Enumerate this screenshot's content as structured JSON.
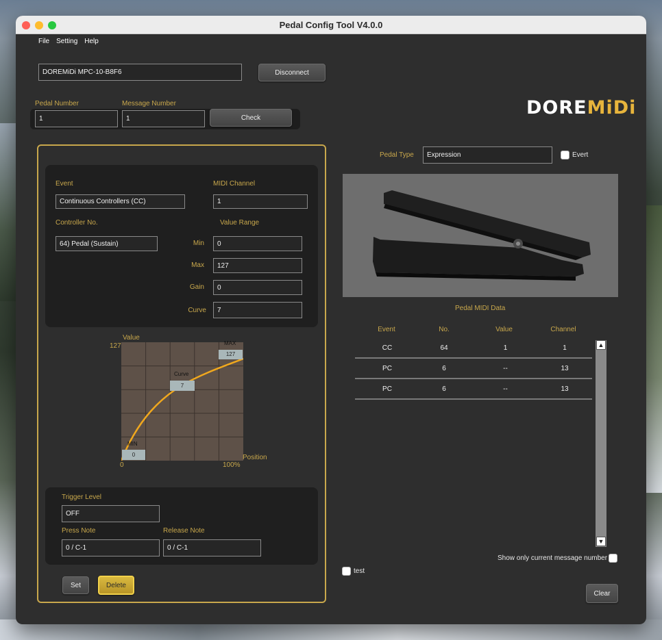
{
  "window": {
    "title": "Pedal Config Tool V4.0.0"
  },
  "menu": [
    "File",
    "Setting",
    "Help"
  ],
  "device": {
    "name": "DOREMiDi MPC-10-B8F6",
    "disconnect_label": "Disconnect"
  },
  "select": {
    "pedal_number_label": "Pedal Number",
    "pedal_number": "1",
    "message_number_label": "Message Number",
    "message_number": "1",
    "check_label": "Check"
  },
  "logo": {
    "part1": "DORE",
    "part2": "MiDi"
  },
  "event_panel": {
    "event_label": "Event",
    "event_value": "Continuous Controllers (CC)",
    "channel_label": "MIDI Channel",
    "channel_value": "1",
    "controller_label": "Controller No.",
    "controller_value": "64) Pedal (Sustain)",
    "value_range_label": "Value Range",
    "min_label": "Min",
    "min_value": "0",
    "max_label": "Max",
    "max_value": "127",
    "gain_label": "Gain",
    "gain_value": "0",
    "curve_label": "Curve",
    "curve_value": "7"
  },
  "graph": {
    "value_label": "Value",
    "y_max": "127",
    "max_label": "MAX",
    "max_value": "127",
    "curve_label": "Curve",
    "curve_value": "7",
    "min_label": "MIN",
    "min_value": "0",
    "x_min": "0",
    "x_max": "100%",
    "position_label": "Position"
  },
  "trigger": {
    "trigger_label": "Trigger Level",
    "trigger_value": "OFF",
    "press_label": "Press Note",
    "press_value": "0 / C-1",
    "release_label": "Release Note",
    "release_value": "0 / C-1"
  },
  "actions": {
    "set_label": "Set",
    "delete_label": "Delete"
  },
  "pedal": {
    "type_label": "Pedal Type",
    "type_value": "Expression",
    "evert_label": "Evert"
  },
  "midi_data": {
    "title": "Pedal MIDI Data",
    "columns": [
      "Event",
      "No.",
      "Value",
      "Channel"
    ],
    "rows": [
      [
        "CC",
        "64",
        "1",
        "1"
      ],
      [
        "PC",
        "6",
        "--",
        "13"
      ],
      [
        "PC",
        "6",
        "--",
        "13"
      ]
    ]
  },
  "show_only_label": "Show only current message number",
  "test_label": "test",
  "clear_label": "Clear",
  "colors": {
    "accent_gold": "#c9a84c",
    "panel_bg": "#2e2e2e"
  }
}
